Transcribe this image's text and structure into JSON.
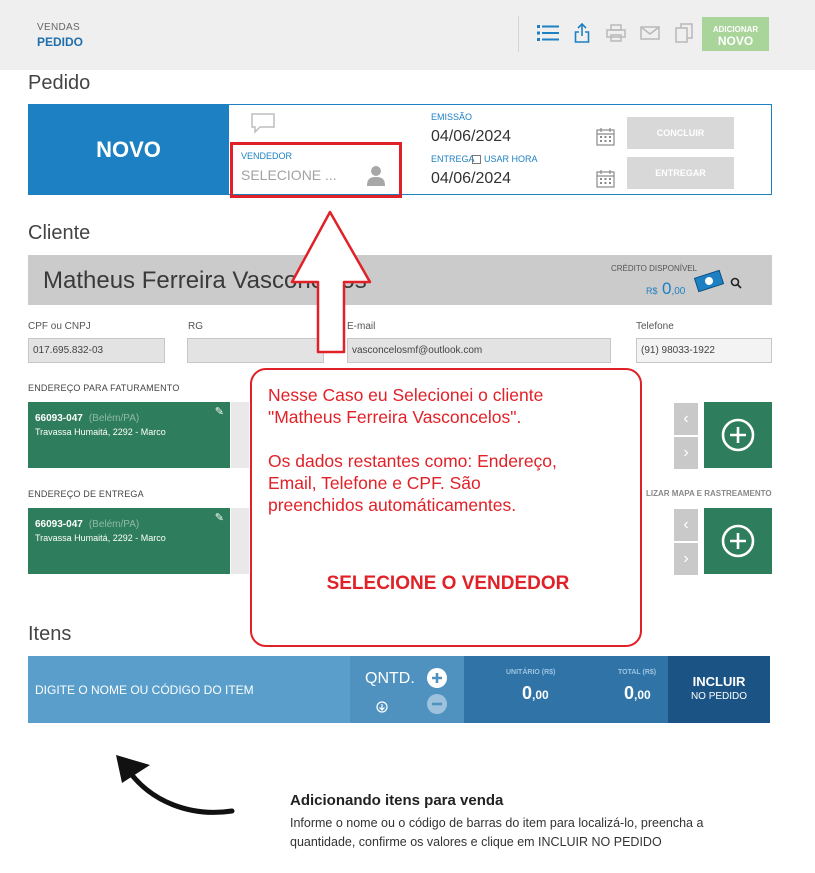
{
  "header": {
    "crumb_section": "VENDAS",
    "crumb_page": "PEDIDO",
    "icons": [
      "list-icon",
      "share-icon",
      "print-icon",
      "mail-icon",
      "copy-icon"
    ],
    "add_button_small": "ADICIONAR",
    "add_button_big": "NOVO",
    "accent": "#1d80c3",
    "add_color": "#a9d49a"
  },
  "pedido": {
    "title": "Pedido",
    "status": "NOVO",
    "vendedor_label": "VENDEDOR",
    "vendedor_placeholder": "SELECIONE ...",
    "emissao_label": "EMISSÃO",
    "emissao_date": "04/06/2024",
    "entrega_label": "ENTREGA",
    "usar_hora_label": "USAR HORA",
    "entrega_date": "04/06/2024",
    "concluir_label": "CONCLUIR",
    "entregar_label": "ENTREGAR"
  },
  "cliente": {
    "title": "Cliente",
    "name": "Matheus Ferreira Vasconcelos",
    "credito_label": "CRÉDITO DISPONÍVEL",
    "credito_currency": "R$",
    "credito_int": "0",
    "credito_dec": ",00",
    "cpf_label": "CPF ou CNPJ",
    "cpf_value": "017.695.832-03",
    "rg_label": "RG",
    "rg_value": "",
    "email_label": "E-mail",
    "email_value": "vasconcelosmf@outlook.com",
    "telefone_label": "Telefone",
    "telefone_value": "(91) 98033-1922",
    "faturamento_label": "ENDEREÇO PARA FATURAMENTO",
    "entrega_label": "ENDEREÇO DE ENTREGA",
    "map_link": "LIZAR MAPA E RASTREAMENTO",
    "addresses": [
      {
        "cep": "66093-047",
        "city": "(Belém/PA)",
        "street": "Travassa Humaitá, 2292 - Marco"
      },
      {
        "cep": "66093-047",
        "city": "(Belém/PA)",
        "street": "Travassa Humaitá, 2292 - Marco"
      }
    ]
  },
  "itens": {
    "title": "Itens",
    "input_placeholder": "DIGITE O NOME OU CÓDIGO DO ITEM",
    "qtnd_label": "QNTD.",
    "unitario_label": "UNITÁRIO (R$)",
    "unitario_int": "0",
    "unitario_dec": ",00",
    "total_label": "TOTAL (R$)",
    "total_int": "0",
    "total_dec": ",00",
    "incluir_label": "INCLUIR",
    "incluir_sub": "NO PEDIDO"
  },
  "callout": {
    "text": "Nesse Caso eu Selecionei o cliente\n\"Matheus Ferreira Vasconcelos\".\n\nOs dados restantes como: Endereço,\nEmail, Telefone e CPF. São\npreenchidos automáticamentes.",
    "emphasis": "SELECIONE O VENDEDOR",
    "color": "#e12128"
  },
  "help": {
    "title": "Adicionando itens para venda",
    "text": "Informe o nome ou o código de barras do item para localizá-lo, preencha a quantidade, confirme os valores e clique em INCLUIR NO PEDIDO"
  }
}
